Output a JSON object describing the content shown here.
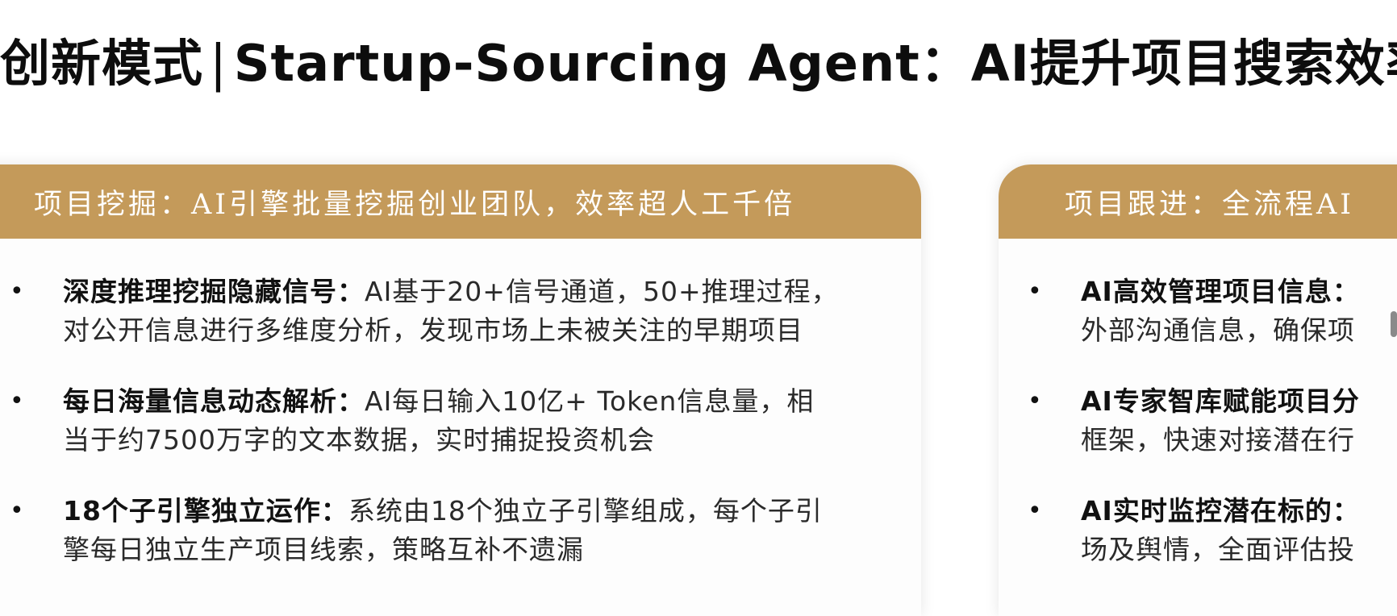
{
  "slide": {
    "title_cn": "创新模式",
    "title_sep": "|",
    "title_en": "Startup-Sourcing Agent：AI提升项目搜索效率"
  },
  "left_card": {
    "header": "项目挖掘：AI引擎批量挖掘创业团队，效率超人工千倍",
    "points": [
      {
        "bullet": "•",
        "lead": "深度推理挖掘隐藏信号：",
        "line1_rest": "AI基于20+信号通道，50+推理过程，",
        "line2": "对公开信息进行多维度分析，发现市场上未被关注的早期项目"
      },
      {
        "bullet": "•",
        "lead": "每日海量信息动态解析：",
        "line1_rest": "AI每日输入10亿+ Token信息量，相",
        "line2": "当于约7500万字的文本数据，实时捕捉投资机会"
      },
      {
        "bullet": "•",
        "lead": "18个子引擎独立运作：",
        "line1_rest": "系统由18个独立子引擎组成，每个子引",
        "line2": "擎每日独立生产项目线索，策略互补不遗漏"
      }
    ]
  },
  "right_card": {
    "header": "项目跟进：全流程AI",
    "points": [
      {
        "bullet": "•",
        "lead": "AI高效管理项目信息：",
        "line2": "外部沟通信息，确保项"
      },
      {
        "bullet": "•",
        "lead": "AI专家智库赋能项目分",
        "line2": "框架，快速对接潜在行"
      },
      {
        "bullet": "•",
        "lead": "AI实时监控潜在标的：",
        "line2": "场及舆情，全面评估投"
      }
    ]
  },
  "colors": {
    "header_bg": "#c49a5a",
    "header_text": "#ffffff"
  }
}
